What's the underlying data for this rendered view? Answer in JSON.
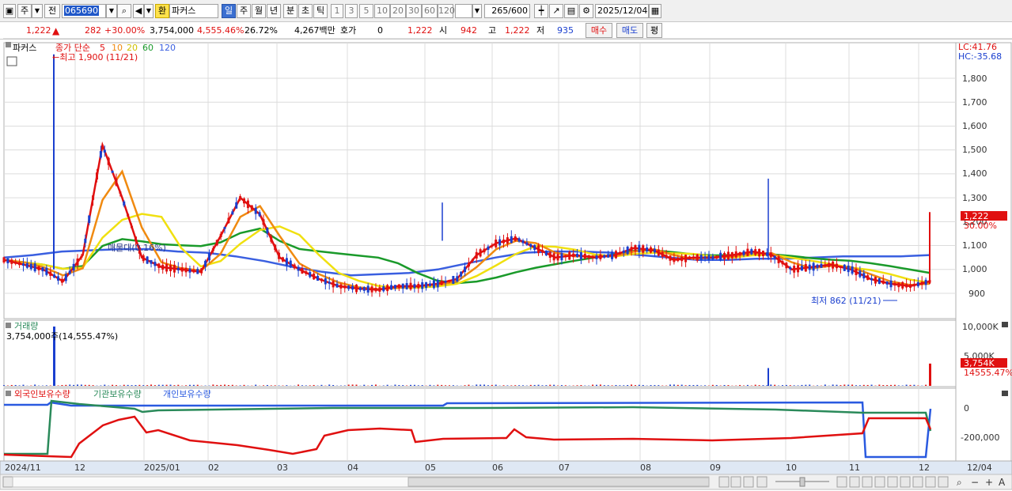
{
  "toolbar": {
    "market_btn": "주",
    "prev_btn": "전",
    "code": "065690",
    "hanja_btn": "환",
    "stock_name": "파커스",
    "period_tabs": [
      "일",
      "주",
      "월",
      "년",
      "분",
      "초",
      "틱"
    ],
    "selected_period": "일",
    "interval_tabs": [
      "1",
      "3",
      "5",
      "10",
      "20",
      "30",
      "60",
      "120"
    ],
    "count": "265",
    "count_max": "/600",
    "date": "2025/12/04"
  },
  "quote": {
    "price": "1,222",
    "change": "282",
    "change_pct": "+30.00%",
    "volume": "3,754,000",
    "volume_pct": "4,555.46%",
    "turnover_pct": "26.72%",
    "amount": "4,267백만",
    "hoga_label": "호가",
    "hoga_value": "0",
    "hoga_price": "1,222",
    "open_label": "시",
    "open": "942",
    "high_label": "고",
    "high": "1,222",
    "low_label": "저",
    "low": "935",
    "buy_btn": "매수",
    "sell_btn": "매도",
    "eval_btn": "평"
  },
  "price_panel": {
    "name_tab": "파커스",
    "ma_label": "종가 단순",
    "ma_periods": [
      "5",
      "10",
      "20",
      "60",
      "120"
    ],
    "high_marker": "←최고 1,900 (11/21)",
    "low_marker": "최저 862 (11/21)",
    "vp_label": "매물대(0.16%)",
    "lc_label": "LC:41.76",
    "hc_label": "HC:-35.68",
    "y_ticks": [
      "1,800",
      "1,700",
      "1,600",
      "1,500",
      "1,400",
      "1,300",
      "1,200",
      "1,100",
      "1,000",
      "900"
    ],
    "last_price_tag": "1,222",
    "last_pct_tag": "30.00%"
  },
  "volume_panel": {
    "title": "거래량",
    "value_label": "3,754,000주(14,555.47%)",
    "y_ticks": [
      "10,000K",
      "5,000K"
    ],
    "last_tag": "3,754K",
    "last_pct_tag": "14555.47%"
  },
  "holdings_panel": {
    "series": [
      "외국인보유수량",
      "기관보유수량",
      "개인보유수량"
    ],
    "y_ticks": [
      "0",
      "-200,000"
    ]
  },
  "x_axis": {
    "labels": [
      "2024/11",
      "12",
      "2025/01",
      "02",
      "03",
      "04",
      "05",
      "06",
      "07",
      "08",
      "09",
      "10",
      "11",
      "12",
      "12/04"
    ]
  },
  "colors": {
    "up": "#e01010",
    "down": "#1a3fcf",
    "ma5": "#e01010",
    "ma10": "#f08a10",
    "ma20": "#f0e010",
    "ma60": "#1a9a2a",
    "ma120": "#3a5fe0",
    "foreign": "#e01010",
    "inst": "#2a8a5a",
    "retail": "#2a5ae0"
  },
  "chart_data": {
    "type": "line",
    "price_range": [
      860,
      1960
    ],
    "high": {
      "date": "11/21",
      "value": 1900
    },
    "low": {
      "date": "11/21",
      "value": 862
    },
    "last_close": 1222,
    "ma_series_close_estimates": {
      "ma5": [
        1040,
        1020,
        1000,
        950,
        1060,
        1520,
        1300,
        1050,
        1010,
        1000,
        990,
        1140,
        1300,
        1230,
        1050,
        1000,
        960,
        930,
        920,
        915,
        930,
        930,
        940,
        960,
        1060,
        1110,
        1130,
        1090,
        1050,
        1060,
        1050,
        1060,
        1090,
        1080,
        1040,
        1050,
        1050,
        1060,
        1075,
        1060,
        1000,
        1010,
        1020,
        1000,
        960,
        940,
        930,
        950
      ],
      "ma120": [
        1050,
        1060,
        1075,
        1080,
        1085,
        1085,
        1075,
        1070,
        1055,
        1035,
        1010,
        990,
        975,
        980,
        985,
        1000,
        1025,
        1050,
        1070,
        1075,
        1075,
        1070,
        1060,
        1050,
        1040,
        1040,
        1045,
        1045,
        1050,
        1055,
        1055,
        1055,
        1060
      ]
    },
    "volume_peak_k": 10000,
    "last_volume_k": 3754
  }
}
